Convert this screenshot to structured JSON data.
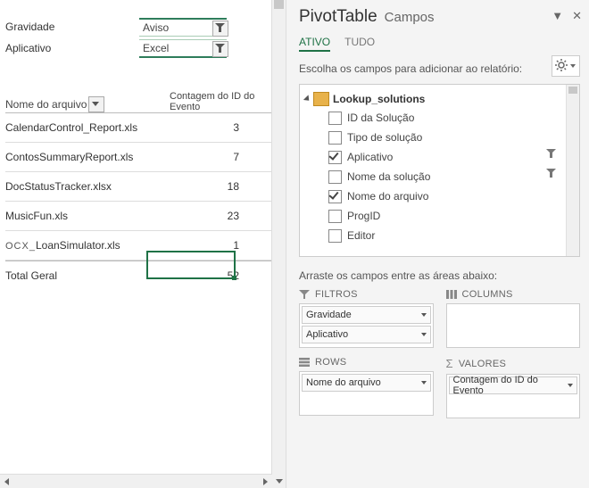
{
  "filters": {
    "items": [
      {
        "label": "Gravidade",
        "value": "Aviso"
      },
      {
        "label": "Aplicativo",
        "value": "Excel"
      }
    ]
  },
  "columns": {
    "row_label": "Nome do arquivo",
    "value_label": "Contagem do ID do Evento"
  },
  "rows": [
    {
      "name": "CalendarControl_Report.xls",
      "count": 3
    },
    {
      "name": "ContosSummaryReport.xls",
      "count": 7
    },
    {
      "name": "DocStatusTracker.xlsx",
      "count": 18
    },
    {
      "name": "MusicFun.xls",
      "count": 23
    },
    {
      "prefix": "OCX_",
      "name": "LoanSimulator.xls",
      "count": 1
    }
  ],
  "total": {
    "label": "Total Geral",
    "value": 52
  },
  "pane": {
    "title": "PivotTable",
    "subtitle": "Campos",
    "tabs": {
      "active": "ATIVO",
      "all": "TUDO"
    },
    "instruction": "Escolha os campos para adicionar ao relatório:",
    "drag_instruction": "Arraste os campos entre as áreas abaixo:"
  },
  "tree": {
    "table": "Lookup_solutions",
    "fields": [
      {
        "label": "ID da Solução",
        "checked": false
      },
      {
        "label": "Tipo de solução",
        "checked": false
      },
      {
        "label": "Aplicativo",
        "checked": true,
        "filter": true
      },
      {
        "label": "Nome da solução",
        "checked": false,
        "filter": true
      },
      {
        "label": "Nome do arquivo",
        "checked": true
      },
      {
        "label": "ProgID",
        "checked": false
      },
      {
        "label": "Editor",
        "checked": false
      }
    ]
  },
  "areas": {
    "filters": {
      "title": "FILTROS",
      "items": [
        "Gravidade",
        "Aplicativo"
      ]
    },
    "columns": {
      "title": "COLUMNS",
      "items": []
    },
    "rows": {
      "title": "ROWS",
      "items": [
        "Nome do arquivo"
      ]
    },
    "values": {
      "title": "VALORES",
      "items": [
        "Contagem do ID do Evento"
      ]
    }
  }
}
